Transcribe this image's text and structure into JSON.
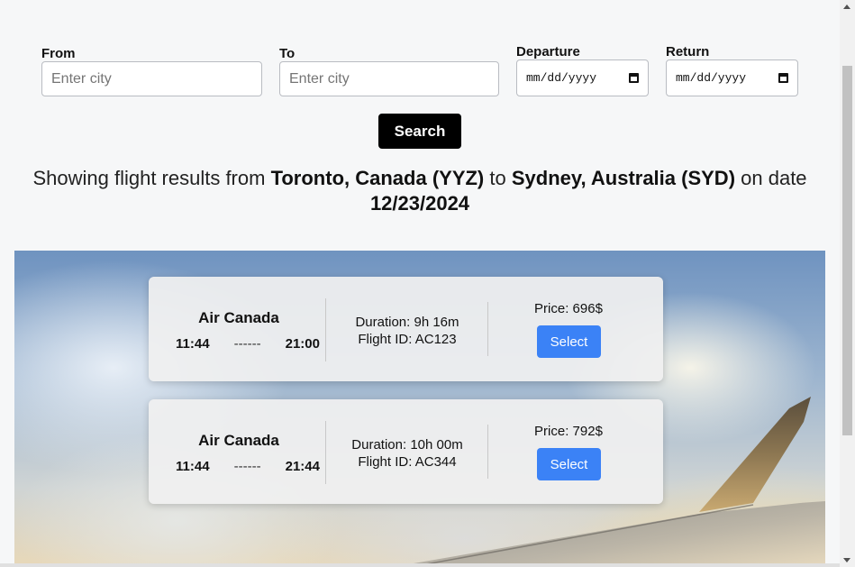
{
  "search_form": {
    "from_label": "From",
    "from_placeholder": "Enter city",
    "to_label": "To",
    "to_placeholder": "Enter city",
    "departure_label": "Departure",
    "departure_value": "mm/dd/yyyy",
    "return_label": "Return",
    "return_value": "mm/dd/yyyy",
    "search_label": "Search"
  },
  "results_heading": {
    "prefix": "Showing flight results from ",
    "origin": "Toronto, Canada (YYZ)",
    "middle": " to ",
    "destination": "Sydney, Australia (SYD)",
    "on": " on date ",
    "date": "12/23/2024"
  },
  "flights": [
    {
      "airline": "Air Canada",
      "depart_time": "11:44",
      "dashes": "------",
      "arrive_time": "21:00",
      "duration": "Duration: 9h 16m",
      "flight_id": "Flight ID: AC123",
      "price": "Price: 696$",
      "select_label": "Select"
    },
    {
      "airline": "Air Canada",
      "depart_time": "11:44",
      "dashes": "------",
      "arrive_time": "21:44",
      "duration": "Duration: 10h 00m",
      "flight_id": "Flight ID: AC344",
      "price": "Price: 792$",
      "select_label": "Select"
    }
  ],
  "colors": {
    "select_button": "#3b82f6",
    "search_button": "#000000",
    "page_background": "#f6f7f8"
  },
  "icons": [
    "calendar-icon",
    "calendar-icon"
  ]
}
